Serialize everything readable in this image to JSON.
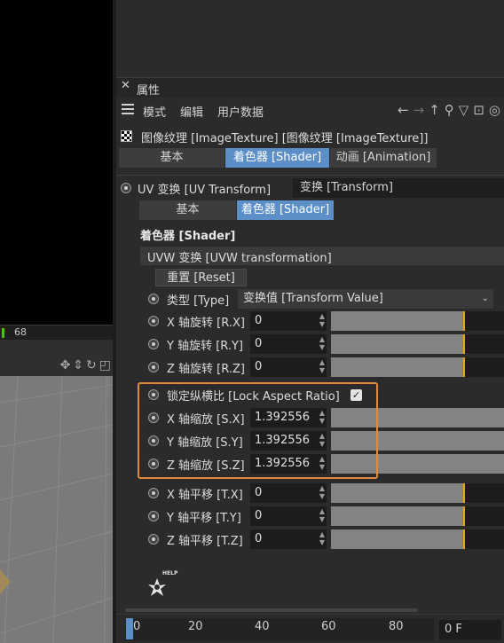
{
  "left": {
    "status_value": "68"
  },
  "attributes": {
    "title": "属性",
    "menu": [
      "模式",
      "编辑",
      "用户数据"
    ],
    "texture_title": "图像纹理 [ImageTexture] [图像纹理 [ImageTexture]]",
    "tabs": [
      "基本",
      "着色器 [Shader]",
      "动画 [Animation]"
    ],
    "active_tab": "着色器 [Shader]"
  },
  "uv": {
    "label": "UV 变换 [UV Transform]",
    "value": "变换 [Transform]",
    "tabs": [
      "基本",
      "着色器 [Shader]"
    ]
  },
  "shader": {
    "heading": "着色器 [Shader]",
    "group": "UVW 变换 [UVW transformation]",
    "reset": "重置 [Reset]",
    "type_label": "类型 [Type]",
    "type_value": "变换值 [Transform Value]",
    "rotation": [
      {
        "label": "X 轴旋转 [R.X]",
        "value": "0",
        "level": 0.0
      },
      {
        "label": "Y 轴旋转 [R.Y]",
        "value": "0",
        "level": 0.0
      },
      {
        "label": "Z 轴旋转 [R.Z]",
        "value": "0",
        "level": 0.0
      }
    ],
    "lock_label": "锁定纵横比 [Lock Aspect Ratio]",
    "lock_checked": true,
    "scale": [
      {
        "label": "X 轴缩放 [S.X]",
        "value": "1.392556"
      },
      {
        "label": "Y 轴缩放 [S.Y]",
        "value": "1.392556"
      },
      {
        "label": "Z 轴缩放 [S.Z]",
        "value": "1.392556"
      }
    ],
    "translation": [
      {
        "label": "X 轴平移 [T.X]",
        "value": "0"
      },
      {
        "label": "Y 轴平移 [T.Y]",
        "value": "0"
      },
      {
        "label": "Z 轴平移 [T.Z]",
        "value": "0"
      }
    ],
    "help_label": "HELP"
  },
  "timeline": {
    "ticks": [
      "0",
      "20",
      "40",
      "60",
      "80"
    ],
    "frame": "0 F"
  },
  "colors": {
    "accent": "#5c8fc8",
    "highlight": "#e08a3c",
    "slider_tick": "#e8a418"
  }
}
